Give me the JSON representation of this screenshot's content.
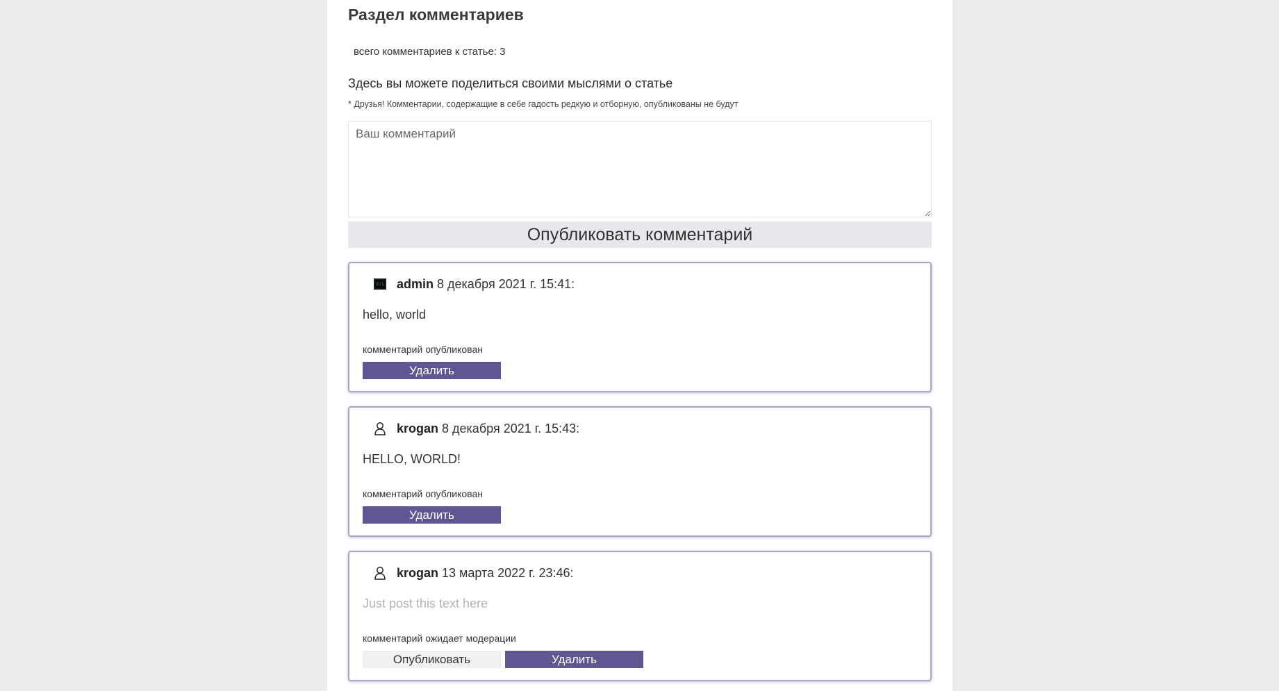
{
  "section": {
    "title": "Раздел комментариев",
    "total_count_text": "всего комментариев к статье: 3"
  },
  "form": {
    "heading": "Здесь вы можете поделиться своими мыслями о статье",
    "note": "* Друзья! Комментарии, содержащие в себе гадость редкую и отборную, опубликованы не будут",
    "placeholder": "Ваш комментарий",
    "value": "",
    "submit_label": "Опубликовать комментарий"
  },
  "comments": [
    {
      "avatar_icon": "terminal-avatar-icon",
      "author": "admin",
      "date": "8 декабря 2021 г. 15:41:",
      "text": "hello, world",
      "status": "комментарий опубликован",
      "delete_label": "Удалить"
    },
    {
      "avatar_icon": "user-icon",
      "author": "krogan",
      "date": "8 декабря 2021 г. 15:43:",
      "text": "HELLO, WORLD!",
      "status": "комментарий опубликован",
      "delete_label": "Удалить"
    },
    {
      "avatar_icon": "user-icon",
      "author": "krogan",
      "date": "13 марта 2022 г. 23:46:",
      "text": "Just post this text here",
      "status": "комментарий ожидает модерации",
      "approve_label": "Опубликовать",
      "delete_label": "Удалить"
    }
  ],
  "colors": {
    "page_background": "#ebebeb",
    "panel_background": "#ffffff",
    "accent": "#5f5791",
    "card_border": "#a9a4c9",
    "submit_background": "#e8e7ec",
    "pending_text": "#b3b3b3"
  }
}
